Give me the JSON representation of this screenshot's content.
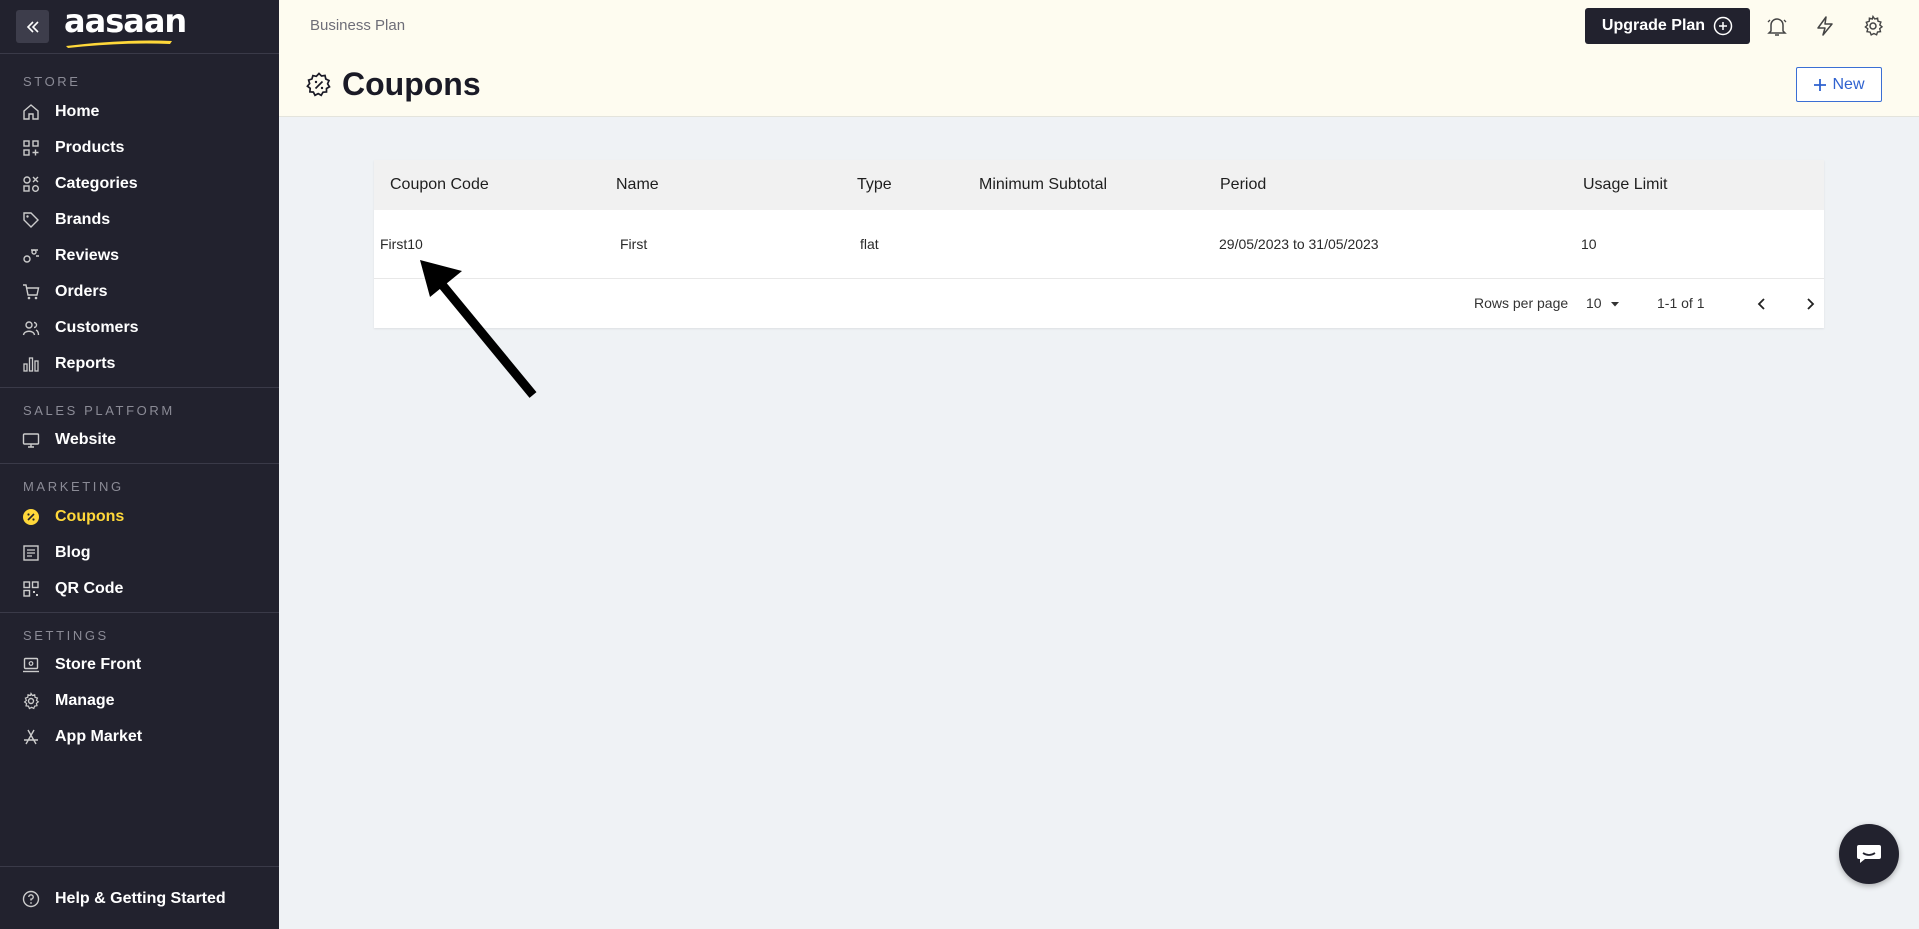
{
  "sidebar": {
    "logo": "aasaan",
    "sections": {
      "store": "STORE",
      "sales_platform": "SALES PLATFORM",
      "marketing": "MARKETING",
      "settings": "SETTINGS"
    },
    "items": {
      "home": "Home",
      "products": "Products",
      "categories": "Categories",
      "brands": "Brands",
      "reviews": "Reviews",
      "orders": "Orders",
      "customers": "Customers",
      "reports": "Reports",
      "website": "Website",
      "coupons": "Coupons",
      "blog": "Blog",
      "qr_code": "QR Code",
      "store_front": "Store Front",
      "manage": "Manage",
      "app_market": "App Market",
      "help": "Help & Getting Started"
    },
    "active_item": "Coupons",
    "accent_color": "#ffd83a"
  },
  "header": {
    "plan": "Business Plan",
    "upgrade_label": "Upgrade Plan",
    "icons": [
      "bell-icon",
      "lightning-icon",
      "gear-icon"
    ]
  },
  "page": {
    "title": "Coupons",
    "new_label": "New"
  },
  "table": {
    "columns": [
      "Coupon Code",
      "Name",
      "Type",
      "Minimum Subtotal",
      "Period",
      "Usage Limit"
    ],
    "rows": [
      {
        "code": "First10",
        "name": "First",
        "type": "flat",
        "min_subtotal": "",
        "period": "29/05/2023 to 31/05/2023",
        "usage_limit": "10"
      }
    ],
    "footer": {
      "rows_per_page_label": "Rows per page",
      "rows_per_page": "10",
      "range": "1-1 of 1"
    }
  }
}
